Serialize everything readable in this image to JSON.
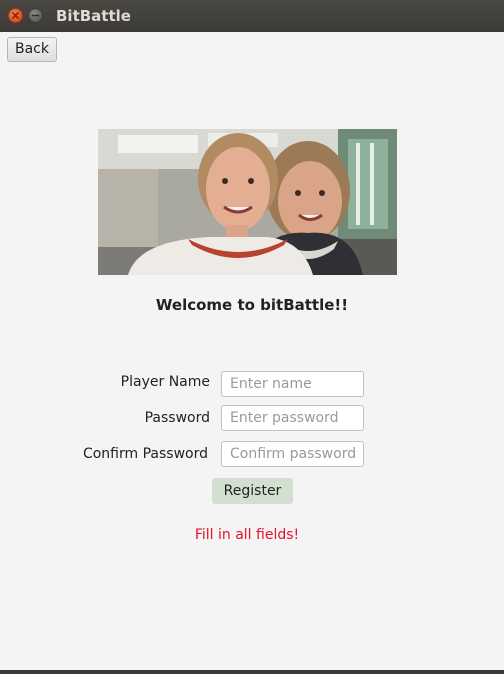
{
  "window": {
    "title": "BitBattle"
  },
  "toolbar": {
    "back_label": "Back"
  },
  "main": {
    "welcome": "Welcome to bitBattle!!",
    "register_label": "Register",
    "error_message": "Fill in all fields!"
  },
  "form": {
    "player_name": {
      "label": "Player Name",
      "value": "",
      "placeholder": "Enter name"
    },
    "password": {
      "label": "Password",
      "value": "",
      "placeholder": "Enter password"
    },
    "confirm_password": {
      "label": "Confirm Password",
      "value": "",
      "placeholder": "Confirm password"
    }
  },
  "icons": {
    "close": "close-icon",
    "minimize": "minimize-icon"
  },
  "colors": {
    "error": "#e8102a",
    "register_button": "#d2e1cf",
    "titlebar": "#3d3c38"
  }
}
